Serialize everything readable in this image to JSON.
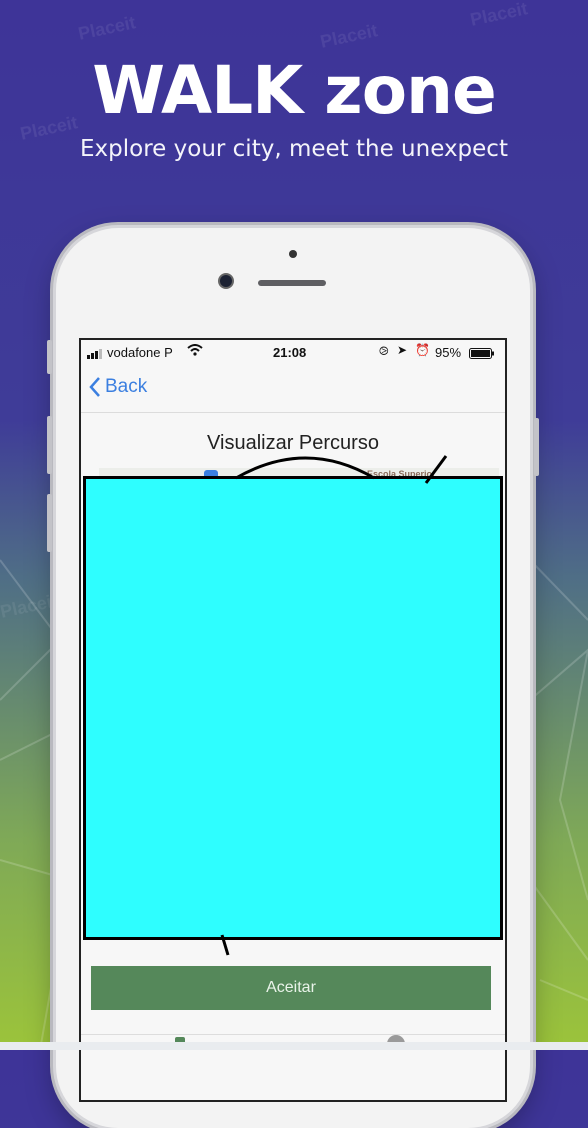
{
  "hero": {
    "title": "WALK zone",
    "subtitle": "Explore your city, meet the unexpect"
  },
  "status_bar": {
    "carrier": "vodafone P",
    "time": "21:08",
    "battery": "95%"
  },
  "nav": {
    "back_label": "Back"
  },
  "screen": {
    "title": "Visualizar Percurso",
    "map_label": "Escola Superior"
  },
  "actions": {
    "accept_label": "Aceitar"
  },
  "watermark": "Placeit",
  "colors": {
    "background_top": "#3e3498",
    "background_bottom": "#9cc43a",
    "overlay": "#2efeff",
    "accept_button": "#55885a",
    "link": "#3b7fe0"
  }
}
